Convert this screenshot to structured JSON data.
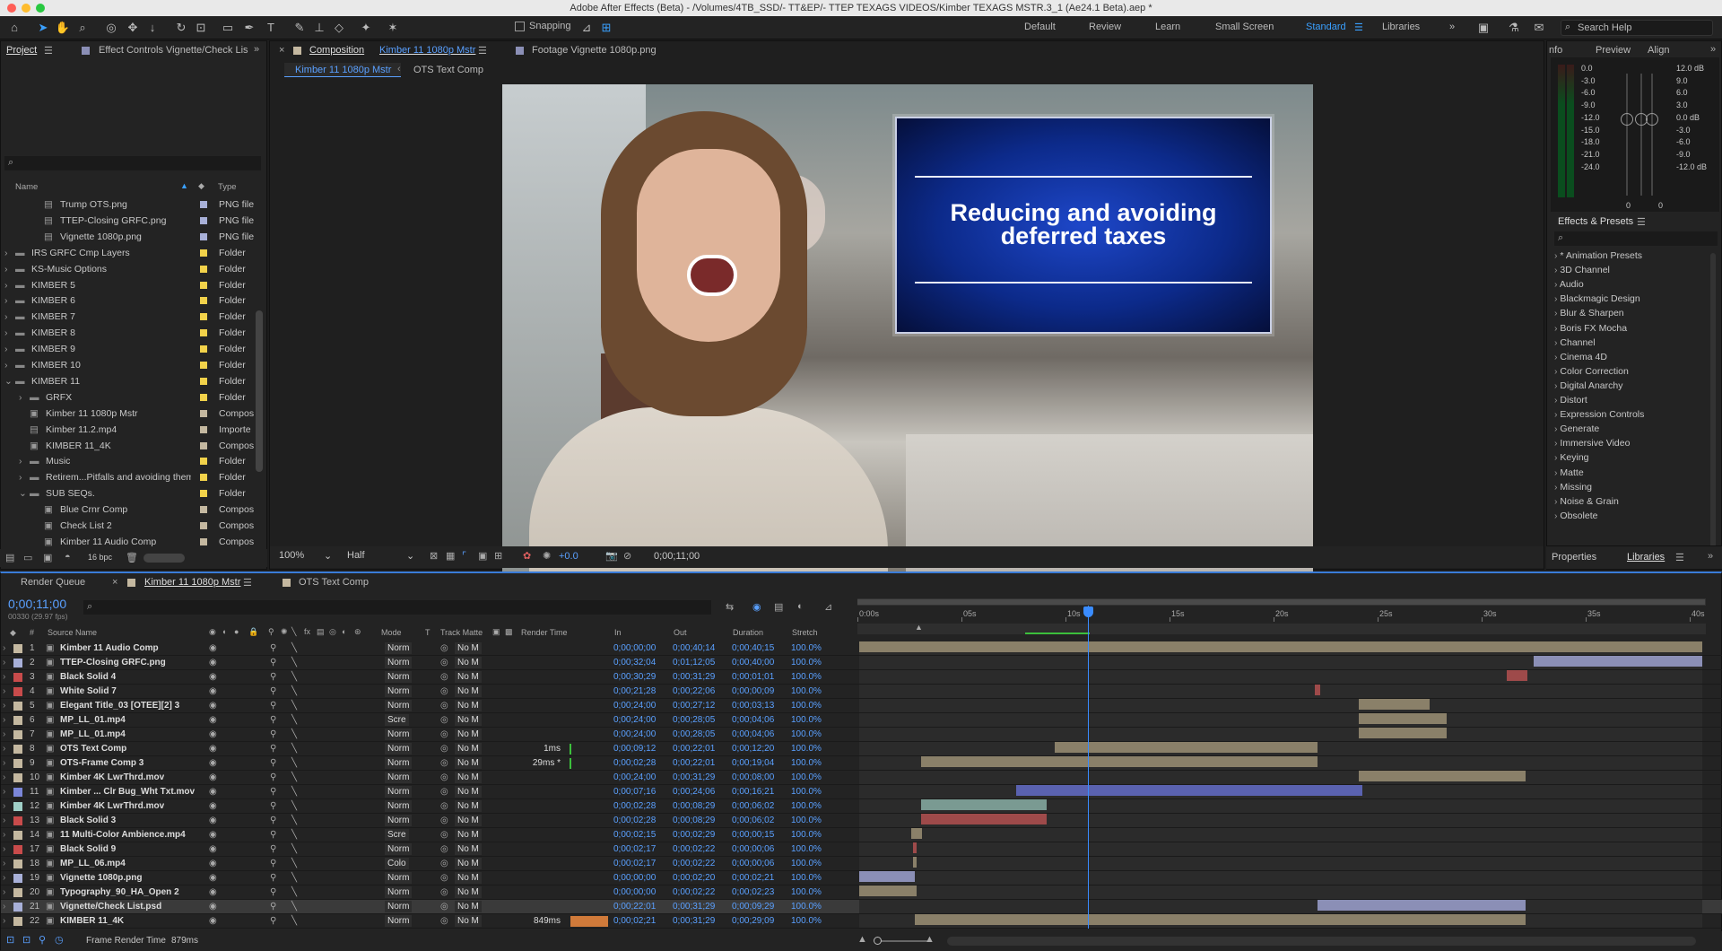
{
  "window_title": "Adobe After Effects (Beta) - /Volumes/4TB_SSD/- TT&EP/- TTEP TEXAGS VIDEOS/Kimber TEXAGS MSTR.3_1 (Ae24.1 Beta).aep *",
  "toolbar": {
    "snapping_label": "Snapping",
    "workspaces": [
      "Default",
      "Review",
      "Learn",
      "Small Screen",
      "Standard",
      "Libraries"
    ],
    "active_workspace": "Standard",
    "search_help_placeholder": "Search Help"
  },
  "project_panel": {
    "tab_project": "Project",
    "tab_effect_controls": "Effect Controls Vignette/Check Lis",
    "search_placeholder": "",
    "col_name": "Name",
    "col_type": "Type",
    "bpc": "16 bpc",
    "items": [
      {
        "name": "Trump OTS.png",
        "type": "PNG file",
        "indent": 2,
        "color": "#a8b0d8",
        "kind": "file"
      },
      {
        "name": "TTEP-Closing GRFC.png",
        "type": "PNG file",
        "indent": 2,
        "color": "#a8b0d8",
        "kind": "file"
      },
      {
        "name": "Vignette 1080p.png",
        "type": "PNG file",
        "indent": 2,
        "color": "#a8b0d8",
        "kind": "file"
      },
      {
        "name": "IRS GRFC Cmp Layers",
        "type": "Folder",
        "indent": 0,
        "color": "#f2d24a",
        "kind": "folder"
      },
      {
        "name": "KS-Music Options",
        "type": "Folder",
        "indent": 0,
        "color": "#f2d24a",
        "kind": "folder"
      },
      {
        "name": "KIMBER 5",
        "type": "Folder",
        "indent": 0,
        "color": "#f2d24a",
        "kind": "folder"
      },
      {
        "name": "KIMBER 6",
        "type": "Folder",
        "indent": 0,
        "color": "#f2d24a",
        "kind": "folder"
      },
      {
        "name": "KIMBER 7",
        "type": "Folder",
        "indent": 0,
        "color": "#f2d24a",
        "kind": "folder"
      },
      {
        "name": "KIMBER 8",
        "type": "Folder",
        "indent": 0,
        "color": "#f2d24a",
        "kind": "folder"
      },
      {
        "name": "KIMBER 9",
        "type": "Folder",
        "indent": 0,
        "color": "#f2d24a",
        "kind": "folder"
      },
      {
        "name": "KIMBER 10",
        "type": "Folder",
        "indent": 0,
        "color": "#f2d24a",
        "kind": "folder"
      },
      {
        "name": "KIMBER 11",
        "type": "Folder",
        "indent": 0,
        "color": "#f2d24a",
        "kind": "folder-open"
      },
      {
        "name": "GRFX",
        "type": "Folder",
        "indent": 1,
        "color": "#f2d24a",
        "kind": "folder"
      },
      {
        "name": "Kimber 11 1080p Mstr",
        "type": "Compos",
        "indent": 1,
        "color": "#c4b8a0",
        "kind": "comp"
      },
      {
        "name": "Kimber 11.2.mp4",
        "type": "Importe",
        "indent": 1,
        "color": "#c4b8a0",
        "kind": "file"
      },
      {
        "name": "KIMBER 11_4K",
        "type": "Compos",
        "indent": 1,
        "color": "#c4b8a0",
        "kind": "comp"
      },
      {
        "name": "Music",
        "type": "Folder",
        "indent": 1,
        "color": "#f2d24a",
        "kind": "folder"
      },
      {
        "name": "Retirem...Pitfalls and avoiding them",
        "type": "Folder",
        "indent": 1,
        "color": "#f2d24a",
        "kind": "folder"
      },
      {
        "name": "SUB SEQs.",
        "type": "Folder",
        "indent": 1,
        "color": "#f2d24a",
        "kind": "folder-open"
      },
      {
        "name": "Blue Crnr Comp",
        "type": "Compos",
        "indent": 2,
        "color": "#c4b8a0",
        "kind": "comp"
      },
      {
        "name": "Check List 2",
        "type": "Compos",
        "indent": 2,
        "color": "#c4b8a0",
        "kind": "comp"
      },
      {
        "name": "Kimber 11 Audio Comp",
        "type": "Compos",
        "indent": 2,
        "color": "#c4b8a0",
        "kind": "comp"
      }
    ]
  },
  "composition_panel": {
    "tab_label": "Composition",
    "comp_name": "Kimber 11 1080p Mstr",
    "footage_tab": "Footage Vignette 1080p.png",
    "breadcrumb_1": "Kimber 11 1080p Mstr",
    "breadcrumb_2": "OTS Text Comp",
    "graphic_text_line1": "Reducing and avoiding",
    "graphic_text_line2": "deferred taxes",
    "zoom": "100%",
    "resolution": "Half",
    "exposure": "+0.0",
    "timecode": "0;00;11;00"
  },
  "right_panel": {
    "tabs": [
      "nfo",
      "Preview",
      "Align"
    ],
    "meter_left_labels": [
      "0.0",
      "-3.0",
      "-6.0",
      "-9.0",
      "-12.0",
      "-15.0",
      "-18.0",
      "-21.0",
      "-24.0"
    ],
    "meter_right_labels": [
      "12.0 dB",
      "9.0",
      "6.0",
      "3.0",
      "0.0 dB",
      "-3.0",
      "-6.0",
      "-9.0",
      "-12.0 dB"
    ],
    "meter_bottom": [
      "0",
      "0"
    ],
    "effects_title": "Effects & Presets",
    "effects_search_placeholder": "",
    "effects": [
      "* Animation Presets",
      "3D Channel",
      "Audio",
      "Blackmagic Design",
      "Blur & Sharpen",
      "Boris FX Mocha",
      "Channel",
      "Cinema 4D",
      "Color Correction",
      "Digital Anarchy",
      "Distort",
      "Expression Controls",
      "Generate",
      "Immersive Video",
      "Keying",
      "Matte",
      "Missing",
      "Noise & Grain",
      "Obsolete"
    ],
    "bottom_tabs": [
      "Properties",
      "Libraries"
    ]
  },
  "timeline": {
    "tabs": [
      "Render Queue",
      "Kimber 11 1080p Mstr",
      "OTS Text Comp"
    ],
    "timecode": "0;00;11;00",
    "frame_info": "00330 (29.97 fps)",
    "search_placeholder": "",
    "headers": {
      "num": "#",
      "source": "Source Name",
      "mode": "Mode",
      "t": "T",
      "track_matte": "Track Matte",
      "render_time": "Render Time",
      "in": "In",
      "out": "Out",
      "duration": "Duration",
      "stretch": "Stretch"
    },
    "ruler": [
      "0:00s",
      "05s",
      "10s",
      "15s",
      "20s",
      "25s",
      "30s",
      "35s",
      "40s"
    ],
    "layers": [
      {
        "num": "1",
        "name": "Kimber 11 Audio Comp",
        "color": "#c4b8a0",
        "mode": "Norm",
        "matte": "No M",
        "rt": "",
        "in": "0;00;00;00",
        "out": "0;00;40;14",
        "dur": "0;00;40;15",
        "st": "100.0%",
        "bar": [
          0.0,
          1.0
        ],
        "barcolor": "#8a8069"
      },
      {
        "num": "2",
        "name": "TTEP-Closing GRFC.png",
        "color": "#a8b0d8",
        "mode": "Norm",
        "matte": "No M",
        "rt": "",
        "in": "0;00;32;04",
        "out": "0;01;12;05",
        "dur": "0;00;40;00",
        "st": "100.0%",
        "bar": [
          0.8,
          1.0
        ],
        "barcolor": "#8b8fb6"
      },
      {
        "num": "3",
        "name": "Black Solid 4",
        "color": "#c84b4b",
        "mode": "Norm",
        "matte": "No M",
        "rt": "",
        "in": "0;00;30;29",
        "out": "0;00;31;29",
        "dur": "0;00;01;01",
        "st": "100.0%",
        "bar": [
          0.768,
          0.793
        ],
        "barcolor": "#9e4a4a"
      },
      {
        "num": "4",
        "name": "White Solid 7",
        "color": "#c84b4b",
        "mode": "Norm",
        "matte": "No M",
        "rt": "",
        "in": "0;00;21;28",
        "out": "0;00;22;06",
        "dur": "0;00;00;09",
        "st": "100.0%",
        "bar": [
          0.54,
          0.547
        ],
        "barcolor": "#9e4a4a"
      },
      {
        "num": "5",
        "name": "Elegant Title_03 [OTEE][2] 3",
        "color": "#c4b8a0",
        "mode": "Norm",
        "matte": "No M",
        "rt": "",
        "in": "0;00;24;00",
        "out": "0;00;27;12",
        "dur": "0;00;03;13",
        "st": "100.0%",
        "bar": [
          0.593,
          0.677
        ],
        "barcolor": "#8a8069"
      },
      {
        "num": "6",
        "name": "MP_LL_01.mp4",
        "color": "#c4b8a0",
        "mode": "Scre",
        "matte": "No M",
        "rt": "",
        "in": "0;00;24;00",
        "out": "0;00;28;05",
        "dur": "0;00;04;06",
        "st": "100.0%",
        "bar": [
          0.593,
          0.697
        ],
        "barcolor": "#8a8069"
      },
      {
        "num": "7",
        "name": "MP_LL_01.mp4",
        "color": "#c4b8a0",
        "mode": "Norm",
        "matte": "No M",
        "rt": "",
        "in": "0;00;24;00",
        "out": "0;00;28;05",
        "dur": "0;00;04;06",
        "st": "100.0%",
        "bar": [
          0.593,
          0.697
        ],
        "barcolor": "#8a8069"
      },
      {
        "num": "8",
        "name": "OTS Text Comp",
        "color": "#c4b8a0",
        "mode": "Norm",
        "matte": "No M",
        "rt": "1ms",
        "in": "0;00;09;12",
        "out": "0;00;22;01",
        "dur": "0;00;12;20",
        "st": "100.0%",
        "bar": [
          0.232,
          0.544
        ],
        "barcolor": "#8a8069"
      },
      {
        "num": "9",
        "name": "OTS-Frame Comp 3",
        "color": "#c4b8a0",
        "mode": "Norm",
        "matte": "No M",
        "rt": "29ms *",
        "in": "0;00;02;28",
        "out": "0;00;22;01",
        "dur": "0;00;19;04",
        "st": "100.0%",
        "bar": [
          0.073,
          0.544
        ],
        "barcolor": "#8a8069"
      },
      {
        "num": "10",
        "name": "Kimber 4K LwrThrd.mov",
        "color": "#c4b8a0",
        "mode": "Norm",
        "matte": "No M",
        "rt": "",
        "in": "0;00;24;00",
        "out": "0;00;31;29",
        "dur": "0;00;08;00",
        "st": "100.0%",
        "bar": [
          0.593,
          0.79
        ],
        "barcolor": "#8a8069"
      },
      {
        "num": "11",
        "name": "Kimber ... Clr Bug_Wht Txt.mov",
        "color": "#7b86d8",
        "mode": "Norm",
        "matte": "No M",
        "rt": "",
        "in": "0;00;07;16",
        "out": "0;00;24;06",
        "dur": "0;00;16;21",
        "st": "100.0%",
        "bar": [
          0.186,
          0.597
        ],
        "barcolor": "#5a62b0"
      },
      {
        "num": "12",
        "name": "Kimber 4K LwrThrd.mov",
        "color": "#a0d0c8",
        "mode": "Norm",
        "matte": "No M",
        "rt": "",
        "in": "0;00;02;28",
        "out": "0;00;08;29",
        "dur": "0;00;06;02",
        "st": "100.0%",
        "bar": [
          0.073,
          0.222
        ],
        "barcolor": "#7a9a92"
      },
      {
        "num": "13",
        "name": "Black Solid 3",
        "color": "#c84b4b",
        "mode": "Norm",
        "matte": "No M",
        "rt": "",
        "in": "0;00;02;28",
        "out": "0;00;08;29",
        "dur": "0;00;06;02",
        "st": "100.0%",
        "bar": [
          0.073,
          0.222
        ],
        "barcolor": "#9e4a4a"
      },
      {
        "num": "14",
        "name": "11 Multi-Color Ambience.mp4",
        "color": "#c4b8a0",
        "mode": "Scre",
        "matte": "No M",
        "rt": "",
        "in": "0;00;02;15",
        "out": "0;00;02;29",
        "dur": "0;00;00;15",
        "st": "100.0%",
        "bar": [
          0.062,
          0.074
        ],
        "barcolor": "#8a8069"
      },
      {
        "num": "17",
        "name": "Black Solid 9",
        "color": "#c84b4b",
        "mode": "Norm",
        "matte": "No M",
        "rt": "",
        "in": "0;00;02;17",
        "out": "0;00;02;22",
        "dur": "0;00;00;06",
        "st": "100.0%",
        "bar": [
          0.064,
          0.068
        ],
        "barcolor": "#9e4a4a"
      },
      {
        "num": "18",
        "name": "MP_LL_06.mp4",
        "color": "#c4b8a0",
        "mode": "Colo",
        "matte": "No M",
        "rt": "",
        "in": "0;00;02;17",
        "out": "0;00;02;22",
        "dur": "0;00;00;06",
        "st": "100.0%",
        "bar": [
          0.064,
          0.068
        ],
        "barcolor": "#8a8069"
      },
      {
        "num": "19",
        "name": "Vignette 1080p.png",
        "color": "#a8b0d8",
        "mode": "Norm",
        "matte": "No M",
        "rt": "",
        "in": "0;00;00;00",
        "out": "0;00;02;20",
        "dur": "0;00;02;21",
        "st": "100.0%",
        "bar": [
          0.0,
          0.066
        ],
        "barcolor": "#8b8fb6"
      },
      {
        "num": "20",
        "name": "Typography_90_HA_Open 2",
        "color": "#c4b8a0",
        "mode": "Norm",
        "matte": "No M",
        "rt": "",
        "in": "0;00;00;00",
        "out": "0;00;02;22",
        "dur": "0;00;02;23",
        "st": "100.0%",
        "bar": [
          0.0,
          0.068
        ],
        "barcolor": "#8a8069"
      },
      {
        "num": "21",
        "name": "Vignette/Check List.psd",
        "color": "#a8b0d8",
        "mode": "Norm",
        "matte": "No M",
        "rt": "",
        "in": "0;00;22;01",
        "out": "0;00;31;29",
        "dur": "0;00;09;29",
        "st": "100.0%",
        "bar": [
          0.544,
          0.79
        ],
        "barcolor": "#8b8fb6"
      },
      {
        "num": "22",
        "name": "KIMBER 11_4K",
        "color": "#c4b8a0",
        "mode": "Norm",
        "matte": "No M",
        "rt": "849ms",
        "in": "0;00;02;21",
        "out": "0;00;31;29",
        "dur": "0;00;29;09",
        "st": "100.0%",
        "bar": [
          0.066,
          0.79
        ],
        "barcolor": "#8a8069"
      }
    ],
    "frame_render_label": "Frame Render Time",
    "frame_render_value": "879ms"
  }
}
